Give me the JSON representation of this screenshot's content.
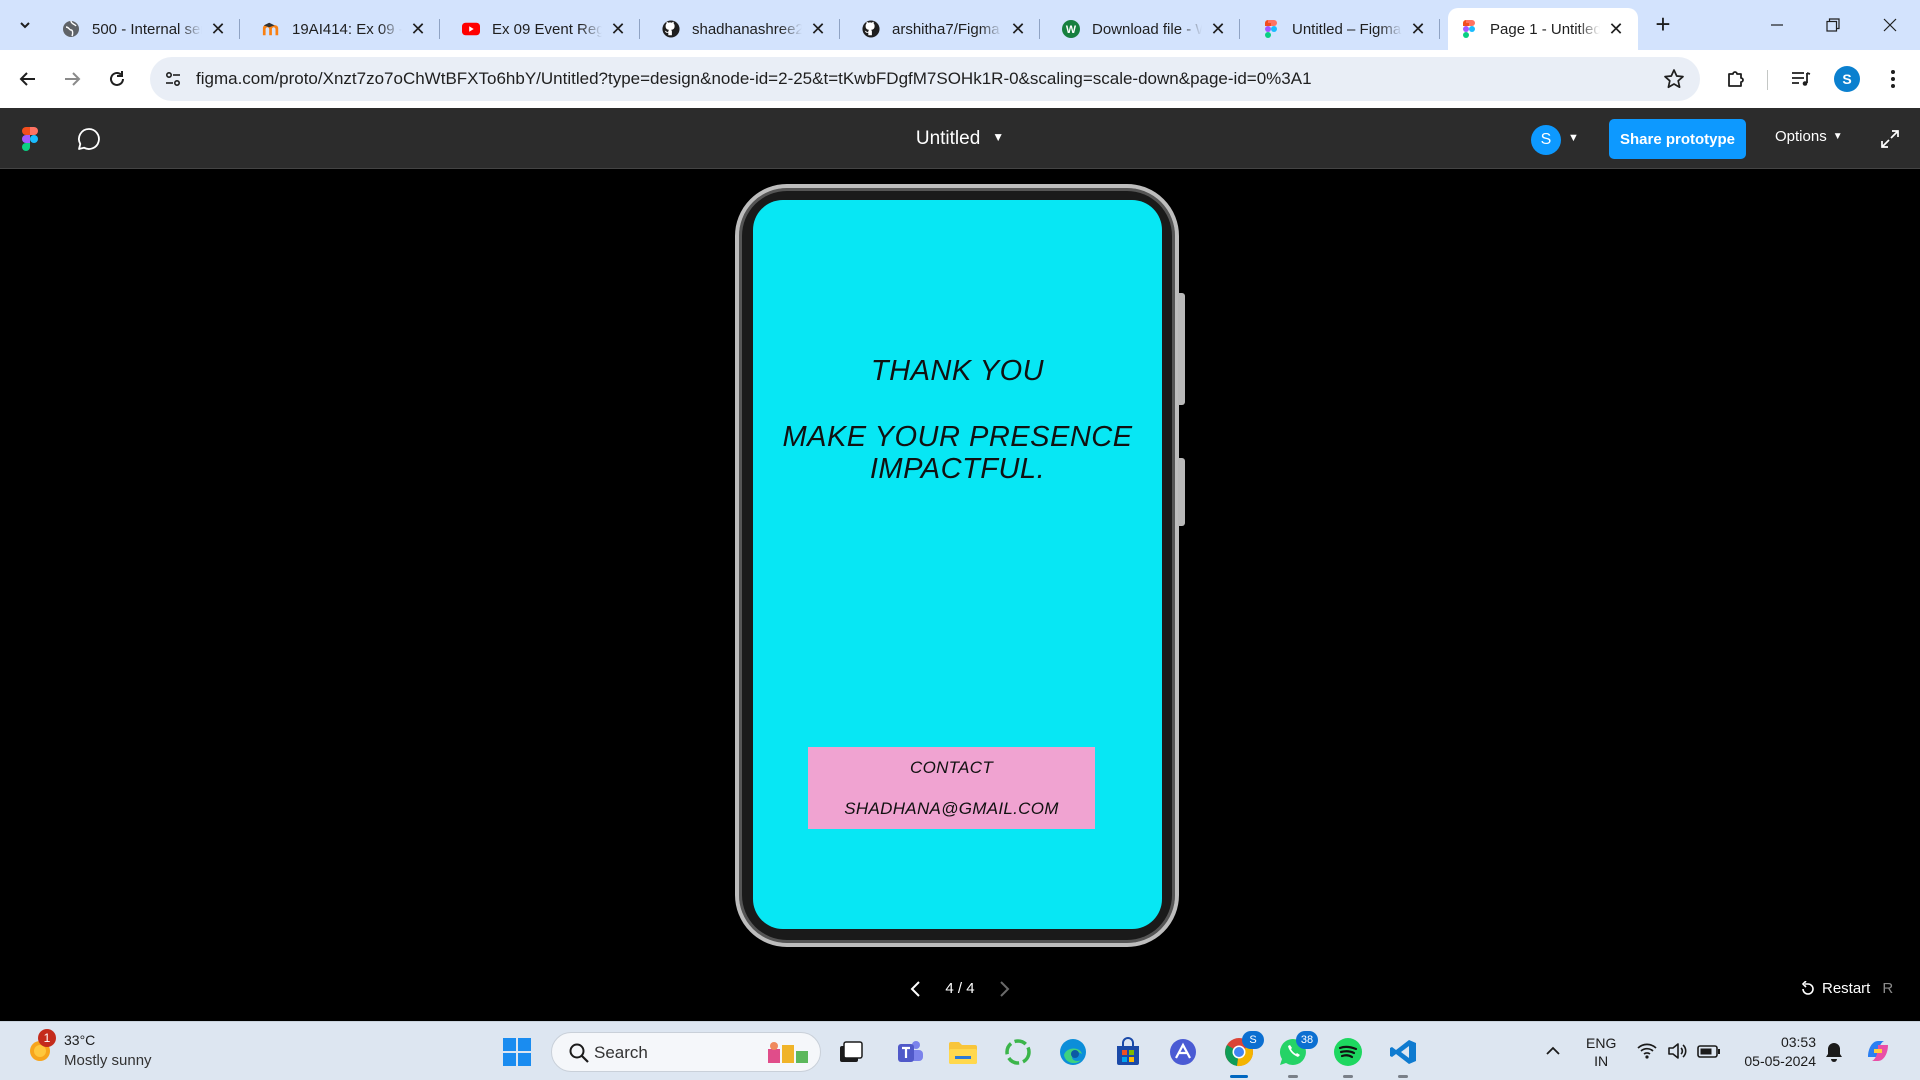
{
  "browser": {
    "tabs": [
      {
        "title": "500 - Internal server error",
        "icon": "globe-icon"
      },
      {
        "title": "19AI414: Ex 09 - ",
        "icon": "moodle-icon"
      },
      {
        "title": "Ex 09 Event Registration",
        "icon": "youtube-icon"
      },
      {
        "title": "shadhanashree2",
        "icon": "github-icon"
      },
      {
        "title": "arshitha7/Figma",
        "icon": "github-icon"
      },
      {
        "title": "Download file - W",
        "icon": "wetransfer-icon"
      },
      {
        "title": "Untitled – Figma",
        "icon": "figma-icon"
      },
      {
        "title": "Page 1 - Untitled",
        "icon": "figma-icon"
      }
    ],
    "url": "figma.com/proto/Xnzt7zo7oChWtBFXTo6hbY/Untitled?type=design&node-id=2-25&t=tKwbFDgfM7SOHk1R-0&scaling=scale-down&page-id=0%3A1",
    "profile_initial": "S"
  },
  "figma": {
    "file_title": "Untitled",
    "avatar_initial": "S",
    "share_label": "Share prototype",
    "options_label": "Options",
    "pager": "4 / 4",
    "restart_label": "Restart",
    "restart_key": "R"
  },
  "frame": {
    "heading": "THANK YOU",
    "tagline_line1": "MAKE YOUR PRESENCE",
    "tagline_line2": "IMPACTFUL.",
    "contact_label": "CONTACT",
    "contact_email": "SHADHANA@GMAIL.COM",
    "colors": {
      "background": "#07e7f4",
      "contact_box": "#f0a3d1"
    }
  },
  "taskbar": {
    "weather_badge": "1",
    "temperature": "33°C",
    "condition": "Mostly sunny",
    "search_label": "Search",
    "whatsapp_badge": "38",
    "chrome_badge": "S",
    "lang_line1": "ENG",
    "lang_line2": "IN",
    "time": "03:53",
    "date": "05-05-2024"
  }
}
